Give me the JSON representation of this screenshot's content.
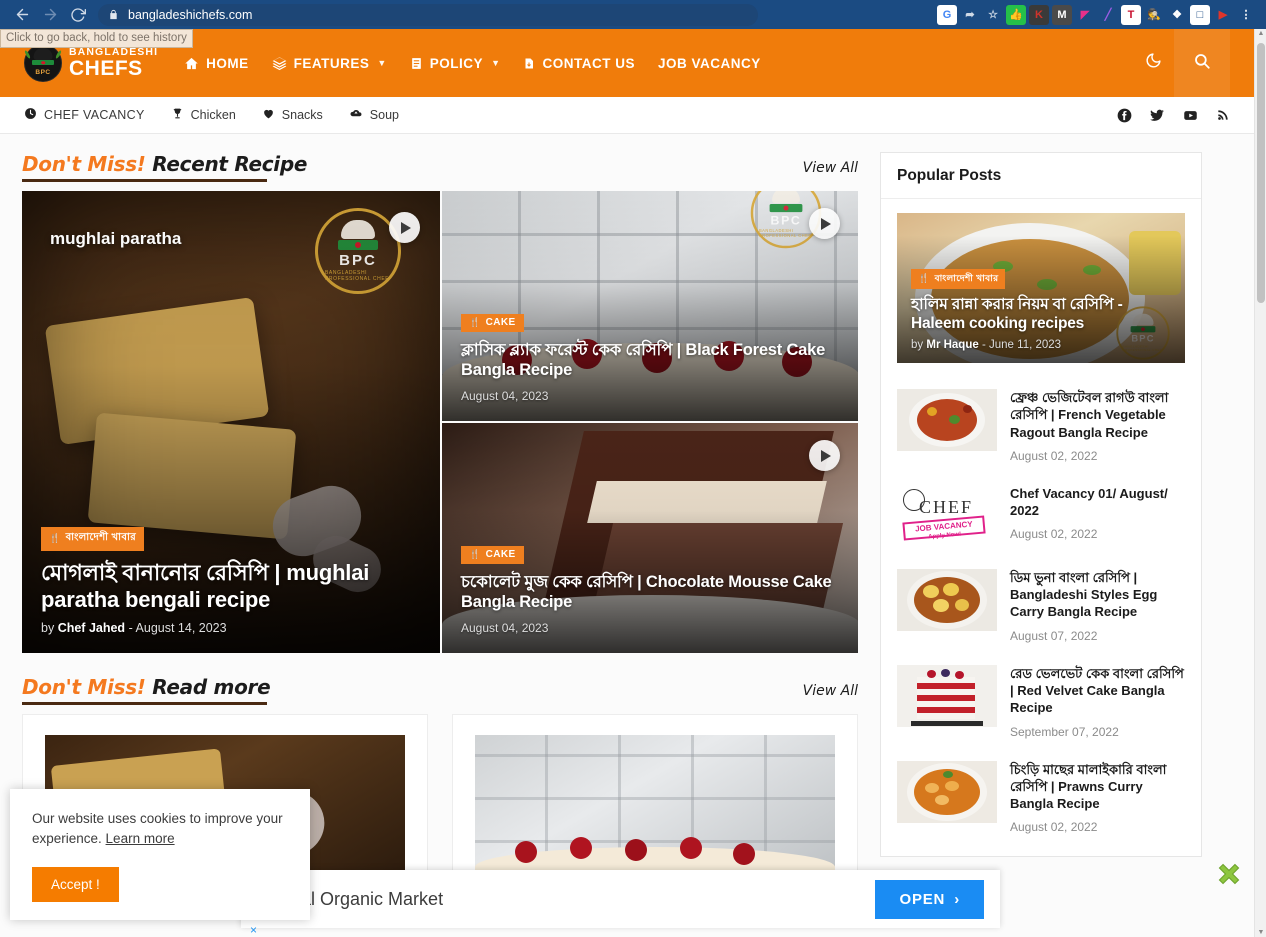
{
  "browser": {
    "url": "bangladeshichefs.com",
    "back_tooltip": "Click to go back, hold to see history",
    "extensions": [
      {
        "name": "google-icon",
        "glyph": "G",
        "bg": "#ffffff",
        "fg": "#4285f4"
      },
      {
        "name": "share-icon",
        "glyph": "➦",
        "bg": "transparent",
        "fg": "#cfd9e6"
      },
      {
        "name": "bookmark-star-icon",
        "glyph": "☆",
        "bg": "transparent",
        "fg": "#cfd9e6"
      },
      {
        "name": "thumbs-up-extension-icon",
        "glyph": "👍",
        "bg": "#25c04a",
        "fg": "#ffffff"
      },
      {
        "name": "kaspersky-extension-icon",
        "glyph": "K",
        "bg": "#3a3a3a",
        "fg": "#d0342c"
      },
      {
        "name": "mailtrack-extension-icon",
        "glyph": "M",
        "bg": "#4a4a4a",
        "fg": "#ffffff"
      },
      {
        "name": "pink-flag-extension-icon",
        "glyph": "◤",
        "bg": "transparent",
        "fg": "#e8308a"
      },
      {
        "name": "grammarly-extension-icon",
        "glyph": "╱",
        "bg": "transparent",
        "fg": "#9b5de5"
      },
      {
        "name": "tampermonkey-extension-icon",
        "glyph": "T",
        "bg": "#ffffff",
        "fg": "#c8102e"
      },
      {
        "name": "agent-extension-icon",
        "glyph": "🕵",
        "bg": "transparent",
        "fg": "#e8c547"
      },
      {
        "name": "puzzle-extensions-icon",
        "glyph": "❖",
        "bg": "transparent",
        "fg": "#ffffff"
      },
      {
        "name": "sidepanel-icon",
        "glyph": "□",
        "bg": "#ffffff",
        "fg": "#1b4b82"
      },
      {
        "name": "video-extension-icon",
        "glyph": "▶",
        "bg": "transparent",
        "fg": "#e0352b"
      },
      {
        "name": "chrome-menu-icon",
        "glyph": "⋮",
        "bg": "transparent",
        "fg": "#ffffff"
      }
    ]
  },
  "site": {
    "logo_top": "BANGLADESHI",
    "logo_bottom": "CHEFS",
    "logo_monogram": "BPC",
    "accent": "#f07c0b",
    "nav": [
      {
        "label": "HOME",
        "icon": "home-icon",
        "caret": false
      },
      {
        "label": "FEATURES",
        "icon": "layers-icon",
        "caret": true
      },
      {
        "label": "POLICY",
        "icon": "document-icon",
        "caret": true
      },
      {
        "label": "CONTACT US",
        "icon": "file-icon",
        "caret": false
      },
      {
        "label": "JOB VACANCY",
        "icon": "",
        "caret": false
      }
    ],
    "header_actions": [
      {
        "name": "dark-mode-toggle",
        "icon": "moon-icon"
      },
      {
        "name": "search-button",
        "icon": "search-icon"
      }
    ],
    "subnav": [
      {
        "label": "CHEF VACANCY",
        "icon": "clock-icon"
      },
      {
        "label": "Chicken",
        "icon": "trophy-icon"
      },
      {
        "label": "Snacks",
        "icon": "heart-icon"
      },
      {
        "label": "Soup",
        "icon": "cloud-upload-icon"
      }
    ],
    "social": [
      {
        "name": "facebook-icon",
        "glyph": "f"
      },
      {
        "name": "twitter-icon",
        "glyph": "t"
      },
      {
        "name": "youtube-icon",
        "glyph": "y"
      },
      {
        "name": "rss-icon",
        "glyph": "r"
      }
    ]
  },
  "sections": {
    "recent": {
      "prefix": "Don't Miss!",
      "title": "Recent Recipe",
      "view_all": "View All"
    },
    "readmore": {
      "prefix": "Don't Miss!",
      "title": "Read more",
      "view_all": "View All"
    }
  },
  "featured": {
    "main": {
      "badge": "বাংলাদেশী খাবার",
      "title": "মোগলাই বানানোর রেসিপি | mughlai paratha bengali recipe",
      "author_prefix": "by",
      "author": "Chef Jahed",
      "date": "August 14, 2023",
      "watermark_label": "mughlai paratha"
    },
    "side": [
      {
        "badge": "CAKE",
        "title": "ক্লাসিক ব্ল্যাক ফরেস্ট কেক রেসিপি | Black Forest Cake Bangla Recipe",
        "date": "August 04, 2023"
      },
      {
        "badge": "CAKE",
        "title": "চকোলেট মুজ কেক রেসিপি | Chocolate Mousse Cake Bangla Recipe",
        "date": "August 04, 2023"
      }
    ]
  },
  "sidebar": {
    "popular_title": "Popular Posts",
    "feature": {
      "badge": "বাংলাদেশী খাবার",
      "title": "হালিম রান্না করার নিয়ম বা রেসিপি - Haleem cooking recipes",
      "author_prefix": "by",
      "author": "Mr Haque",
      "date": "June 11, 2023"
    },
    "items": [
      {
        "title": "ফ্রেঞ্চ ভেজিটেবল রাগউ বাংলা রেসিপি | French Vegetable Ragout Bangla Recipe",
        "date": "August 02, 2022",
        "thumb": "ragout"
      },
      {
        "title": "Chef Vacancy 01/ August/ 2022",
        "date": "August 02, 2022",
        "thumb": "vacancy"
      },
      {
        "title": "ডিম ভুনা বাংলা রেসিপি | Bangladeshi Styles Egg Carry Bangla Recipe",
        "date": "August 07, 2022",
        "thumb": "egg"
      },
      {
        "title": "রেড ভেলভেট কেক বাংলা রেসিপি | Red Velvet Cake Bangla Recipe",
        "date": "September 07, 2022",
        "thumb": "redvelvet"
      },
      {
        "title": "চিংড়ি মাছের মালাইকারি বাংলা রেসিপি | Prawns Curry Bangla Recipe",
        "date": "August 02, 2022",
        "thumb": "prawn"
      }
    ]
  },
  "cookie": {
    "text": "Our website uses cookies to improve your experience. ",
    "link": "Learn more",
    "accept": "Accept !"
  },
  "ad": {
    "text": "r Local Organic Market",
    "open": "OPEN",
    "chevron": "›",
    "close_x": "×"
  }
}
